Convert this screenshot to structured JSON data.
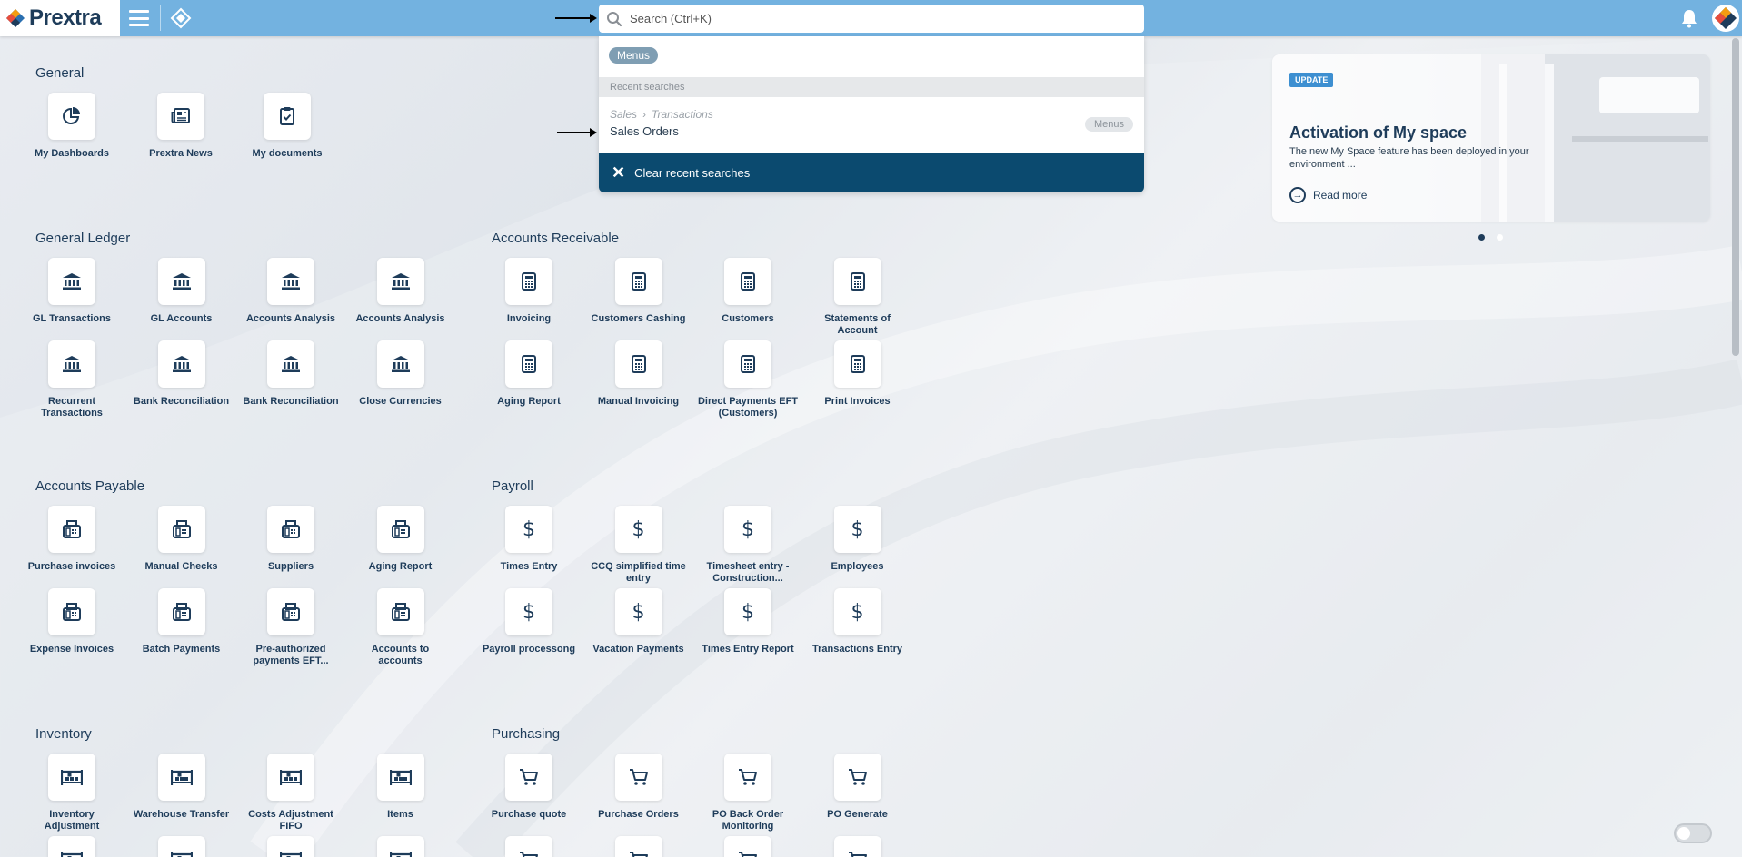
{
  "app": {
    "logo_text": "Prextra"
  },
  "search": {
    "placeholder": "Search (Ctrl+K)"
  },
  "dropdown": {
    "chip": "Menus",
    "recent_header": "Recent searches",
    "recent": [
      {
        "crumb1": "Sales",
        "crumb2": "Transactions",
        "title": "Sales Orders",
        "tag": "Menus"
      }
    ],
    "clear_label": "Clear recent searches"
  },
  "sections": {
    "general": {
      "title": "General",
      "items": [
        "My Dashboards",
        "Prextra News",
        "My documents"
      ]
    },
    "general_ledger": {
      "title": "General Ledger",
      "items": [
        "GL Transactions",
        "GL Accounts",
        "Accounts Analysis",
        "Accounts Analysis",
        "Recurrent Transactions",
        "Bank Reconciliation",
        "Bank Reconciliation",
        "Close Currencies"
      ]
    },
    "accounts_receivable": {
      "title": "Accounts Receivable",
      "items": [
        "Invoicing",
        "Customers Cashing",
        "Customers",
        "Statements of Account",
        "Aging Report",
        "Manual Invoicing",
        "Direct Payments EFT (Customers)",
        "Print Invoices"
      ]
    },
    "accounts_payable": {
      "title": "Accounts Payable",
      "items": [
        "Purchase invoices",
        "Manual Checks",
        "Suppliers",
        "Aging Report",
        "Expense Invoices",
        "Batch Payments",
        "Pre-authorized payments EFT...",
        "Accounts to accounts"
      ]
    },
    "payroll": {
      "title": "Payroll",
      "items": [
        "Times Entry",
        "CCQ simplified time entry",
        "Timesheet entry - Construction...",
        "Employees",
        "Payroll processong",
        "Vacation Payments",
        "Times Entry Report",
        "Transactions Entry"
      ]
    },
    "inventory": {
      "title": "Inventory",
      "items": [
        "Inventory Adjustment",
        "Warehouse Transfer",
        "Costs Adjustment FIFO",
        "Items"
      ]
    },
    "purchasing": {
      "title": "Purchasing",
      "items": [
        "Purchase quote",
        "Purchase Orders",
        "PO Back Order Monitoring",
        "PO Generate"
      ]
    }
  },
  "update_card": {
    "badge": "UPDATE",
    "title": "Activation of My space",
    "description": "The new My Space feature has been deployed in your environment ...",
    "read_more": "Read more"
  },
  "icons": {
    "general": [
      "pie-chart-icon",
      "newspaper-icon",
      "clipboard-check-icon"
    ],
    "general_ledger": "bank-icon",
    "accounts_receivable": "calculator-icon",
    "accounts_payable": "fax-icon",
    "payroll": "dollar-icon",
    "inventory": "warehouse-icon",
    "purchasing": "cart-icon"
  },
  "colors": {
    "topbar": "#73b2e0",
    "clear_button": "#0b4a6f",
    "brand_text": "#1e3c5a"
  }
}
